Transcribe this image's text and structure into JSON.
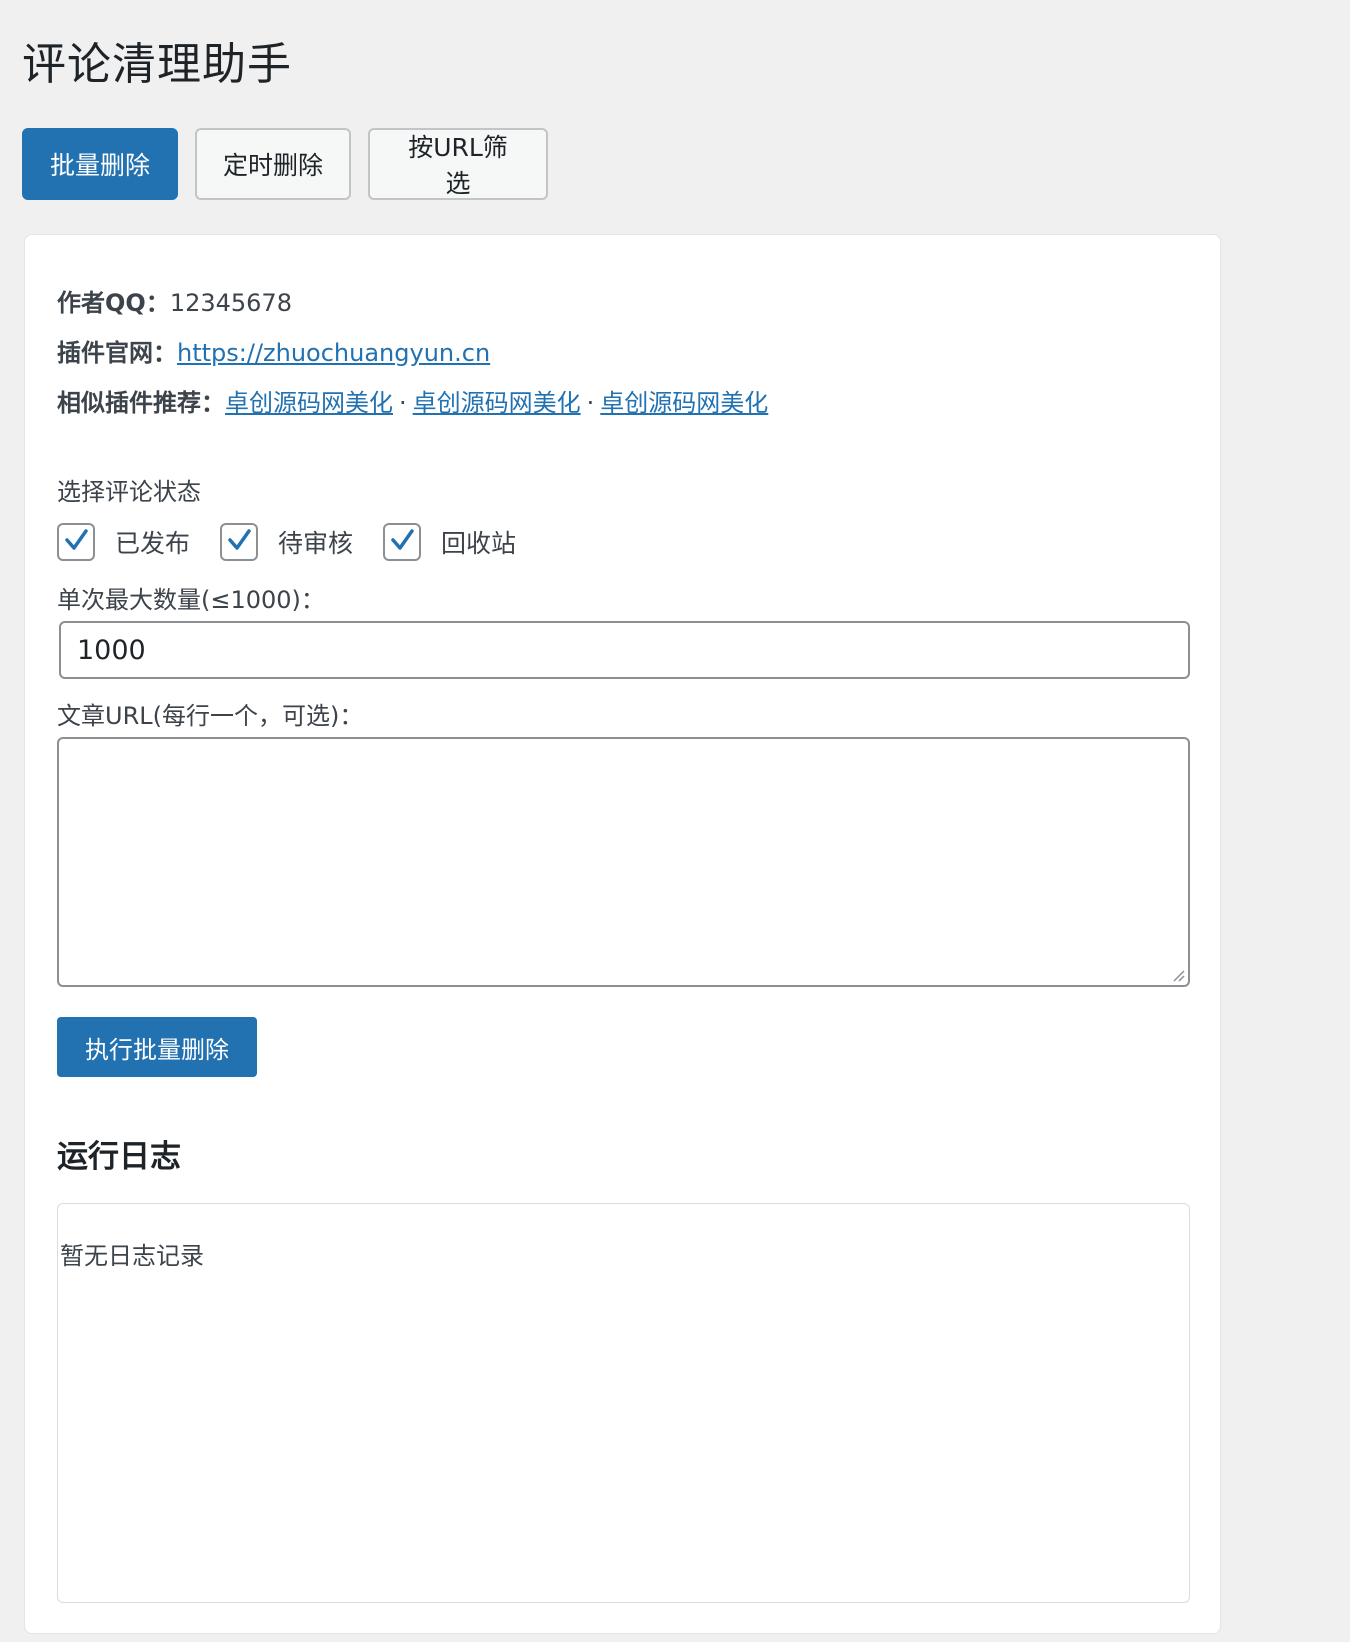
{
  "page": {
    "title": "评论清理助手"
  },
  "tabs": [
    {
      "label": "批量删除",
      "active": true
    },
    {
      "label": "定时删除",
      "active": false
    },
    {
      "label": "按URL筛选",
      "active": false
    }
  ],
  "info": {
    "author_label": "作者QQ：",
    "author_value": "12345678",
    "site_label": "插件官网：",
    "site_link": "https://zhuochuangyun.cn",
    "related_label": "相似插件推荐：",
    "related_links": [
      "卓创源码网美化",
      "卓创源码网美化",
      "卓创源码网美化"
    ],
    "separator": "·"
  },
  "form": {
    "status_label": "选择评论状态",
    "statuses": [
      {
        "label": "已发布",
        "checked": true
      },
      {
        "label": "待审核",
        "checked": true
      },
      {
        "label": "回收站",
        "checked": true
      }
    ],
    "max_label": "单次最大数量(≤1000)：",
    "max_value": "1000",
    "url_label": "文章URL(每行一个，可选)：",
    "url_value": "",
    "submit_label": "执行批量删除"
  },
  "log": {
    "heading": "运行日志",
    "empty_text": "暂无日志记录"
  },
  "colors": {
    "primary": "#2271b1",
    "background": "#f0f0f1",
    "link": "#2271b1"
  }
}
